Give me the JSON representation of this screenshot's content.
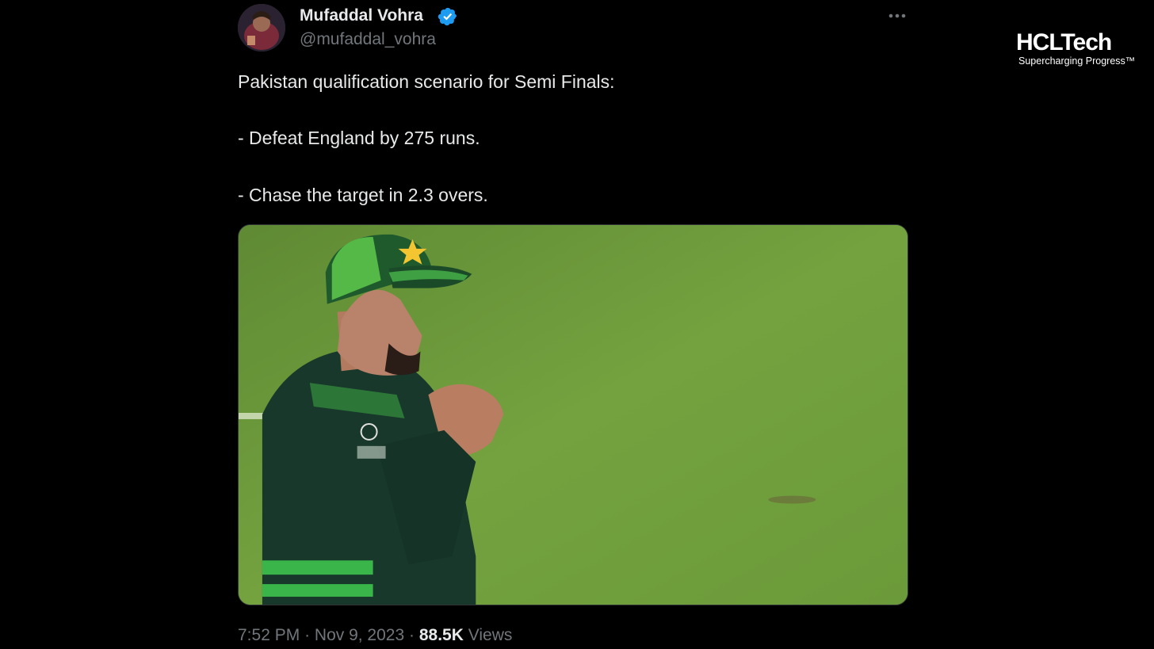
{
  "tweet": {
    "author": {
      "display_name": "Mufaddal Vohra",
      "handle": "@mufaddal_vohra",
      "verified": true,
      "avatar_icon": "avatar-photo"
    },
    "text_lines": [
      "Pakistan qualification scenario for Semi Finals:",
      "- Defeat England by 275 runs.",
      "- Chase the target in 2.3 overs."
    ],
    "media_description_icon": "photo",
    "time": "7:52 PM",
    "separator": "·",
    "date": "Nov 9, 2023",
    "views_count": "88.5K",
    "views_label": "Views",
    "more_icon": "more-horizontal-icon"
  },
  "watermark": {
    "brand": "HCLTech",
    "tagline": "Supercharging Progress™"
  },
  "colors": {
    "background": "#000000",
    "text_primary": "#e7e9ea",
    "text_secondary": "#71767b",
    "verified_blue": "#1d9bf0"
  }
}
